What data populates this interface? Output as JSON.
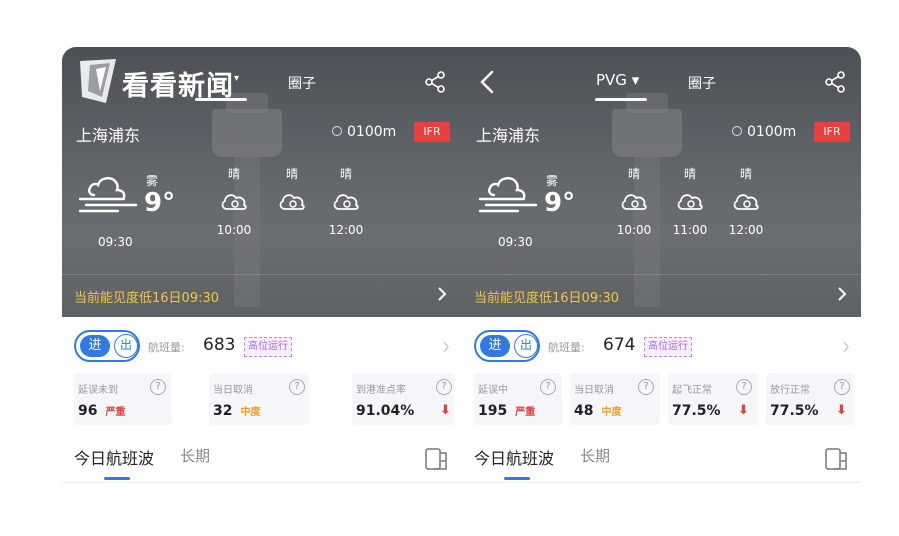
{
  "colors": {
    "alert": "#f0c744",
    "ifr": "#e8403f",
    "accent": "#2f7ae5",
    "severe": "#e8403f",
    "moderate": "#f0a020",
    "badge": "#a56ed8"
  },
  "left": {
    "logo_text": "看看新闻",
    "airport_tab": "",
    "circle_tab": "圈子",
    "city": "上海浦东",
    "visibility": "0100m",
    "ifr": "IFR",
    "now": {
      "condition": "雾",
      "temp": "9°",
      "time": "09:30",
      "icon": "fog-icon"
    },
    "forecast": [
      {
        "cond": "晴",
        "time": "10:00",
        "icon": "sun-cloud-icon"
      },
      {
        "cond": "晴",
        "time": "",
        "icon": "sun-cloud-icon"
      },
      {
        "cond": "晴",
        "time": "12:00",
        "icon": "sun-cloud-icon"
      }
    ],
    "alert": "当前能见度低16日09:30",
    "toggle": {
      "in": "进",
      "out": "出"
    },
    "count_label": "航班量:",
    "count": "683",
    "badge": "高位运行",
    "stats": [
      {
        "label": "延误未到",
        "value": "96",
        "severity": "严重",
        "sev_color": "#e8403f"
      },
      {
        "label": "当日取消",
        "value": "32",
        "severity": "中度",
        "sev_color": "#f0a020"
      },
      {
        "label": "到港准点率",
        "value": "91.04%",
        "arrow": "⬇"
      }
    ],
    "tab_today": "今日航班波",
    "tab_long": "长期"
  },
  "right": {
    "airport_tab": "PVG ▾",
    "circle_tab": "圈子",
    "city": "上海浦东",
    "visibility": "0100m",
    "ifr": "IFR",
    "now": {
      "condition": "雾",
      "temp": "9°",
      "time": "09:30",
      "icon": "fog-icon"
    },
    "forecast": [
      {
        "cond": "晴",
        "time": "10:00",
        "icon": "sun-cloud-icon"
      },
      {
        "cond": "晴",
        "time": "11:00",
        "icon": "sun-cloud-icon"
      },
      {
        "cond": "晴",
        "time": "12:00",
        "icon": "sun-cloud-icon"
      }
    ],
    "alert": "当前能见度低16日09:30",
    "toggle": {
      "in": "进",
      "out": "出"
    },
    "count_label": "航班量:",
    "count": "674",
    "badge": "高位运行",
    "stats": [
      {
        "label": "延误中",
        "value": "195",
        "severity": "严重",
        "sev_color": "#e8403f"
      },
      {
        "label": "当日取消",
        "value": "48",
        "severity": "中度",
        "sev_color": "#f0a020"
      },
      {
        "label": "起飞正常",
        "value": "77.5%",
        "arrow": "⬇"
      },
      {
        "label": "放行正常",
        "value": "77.5%",
        "arrow": "⬇"
      }
    ],
    "tab_today": "今日航班波",
    "tab_long": "长期"
  }
}
